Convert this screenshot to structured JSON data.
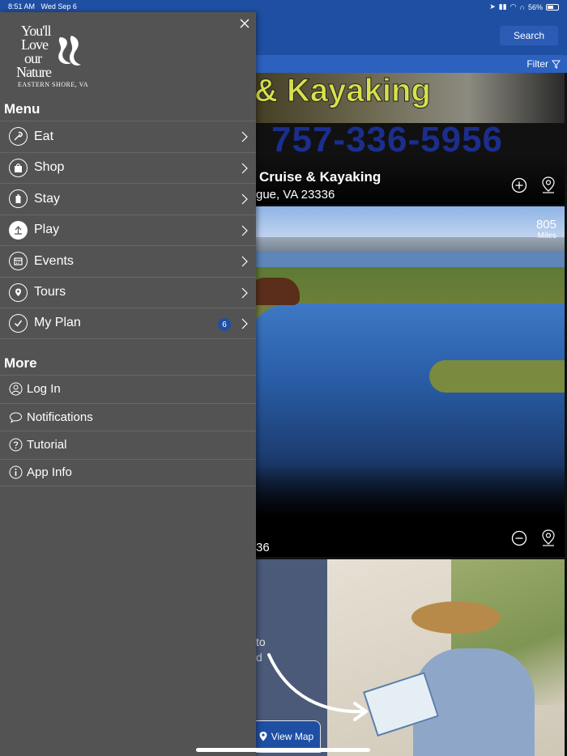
{
  "status_bar": {
    "time": "8:51 AM",
    "date": "Wed Sep 6",
    "battery": "56%",
    "battery_level": 0.56
  },
  "header": {
    "search_label": "Search",
    "filter_label": "Filter"
  },
  "cards": [
    {
      "sign_text": "& Kayaking",
      "phone": "757-336-5956",
      "title": "Cruise & Kayaking",
      "address": "gue, VA 23336",
      "add_icon": "plus-circle-icon",
      "map_icon": "map-pin-icon"
    },
    {
      "distance": "805",
      "distance_unit": "Miles",
      "address": "36",
      "remove_icon": "minus-circle-icon",
      "map_icon": "map-pin-icon"
    },
    {
      "promo_line1": "to",
      "promo_line2": "d",
      "view_map_label": "View Map"
    }
  ],
  "drawer": {
    "logo": {
      "line1": "You'll",
      "line2": "Love",
      "line3": "our",
      "line4": "Nature",
      "line5": "EASTERN SHORE, VA"
    },
    "menu_title": "Menu",
    "menu_items": [
      {
        "label": "Eat",
        "icon": "eat-icon"
      },
      {
        "label": "Shop",
        "icon": "shop-icon"
      },
      {
        "label": "Stay",
        "icon": "stay-icon"
      },
      {
        "label": "Play",
        "icon": "play-icon"
      },
      {
        "label": "Events",
        "icon": "calendar-icon"
      },
      {
        "label": "Tours",
        "icon": "tours-icon"
      },
      {
        "label": "My Plan",
        "icon": "check-icon",
        "badge": "6"
      }
    ],
    "more_title": "More",
    "more_items": [
      {
        "label": "Log In",
        "icon": "user-icon"
      },
      {
        "label": "Notifications",
        "icon": "chat-bubble-icon"
      },
      {
        "label": "Tutorial",
        "icon": "question-icon"
      },
      {
        "label": "App Info",
        "icon": "info-icon"
      }
    ]
  },
  "colors": {
    "header_blue": "#1f4fa3",
    "drawer_gray": "#535353",
    "badge_blue": "#1f4fa3"
  }
}
